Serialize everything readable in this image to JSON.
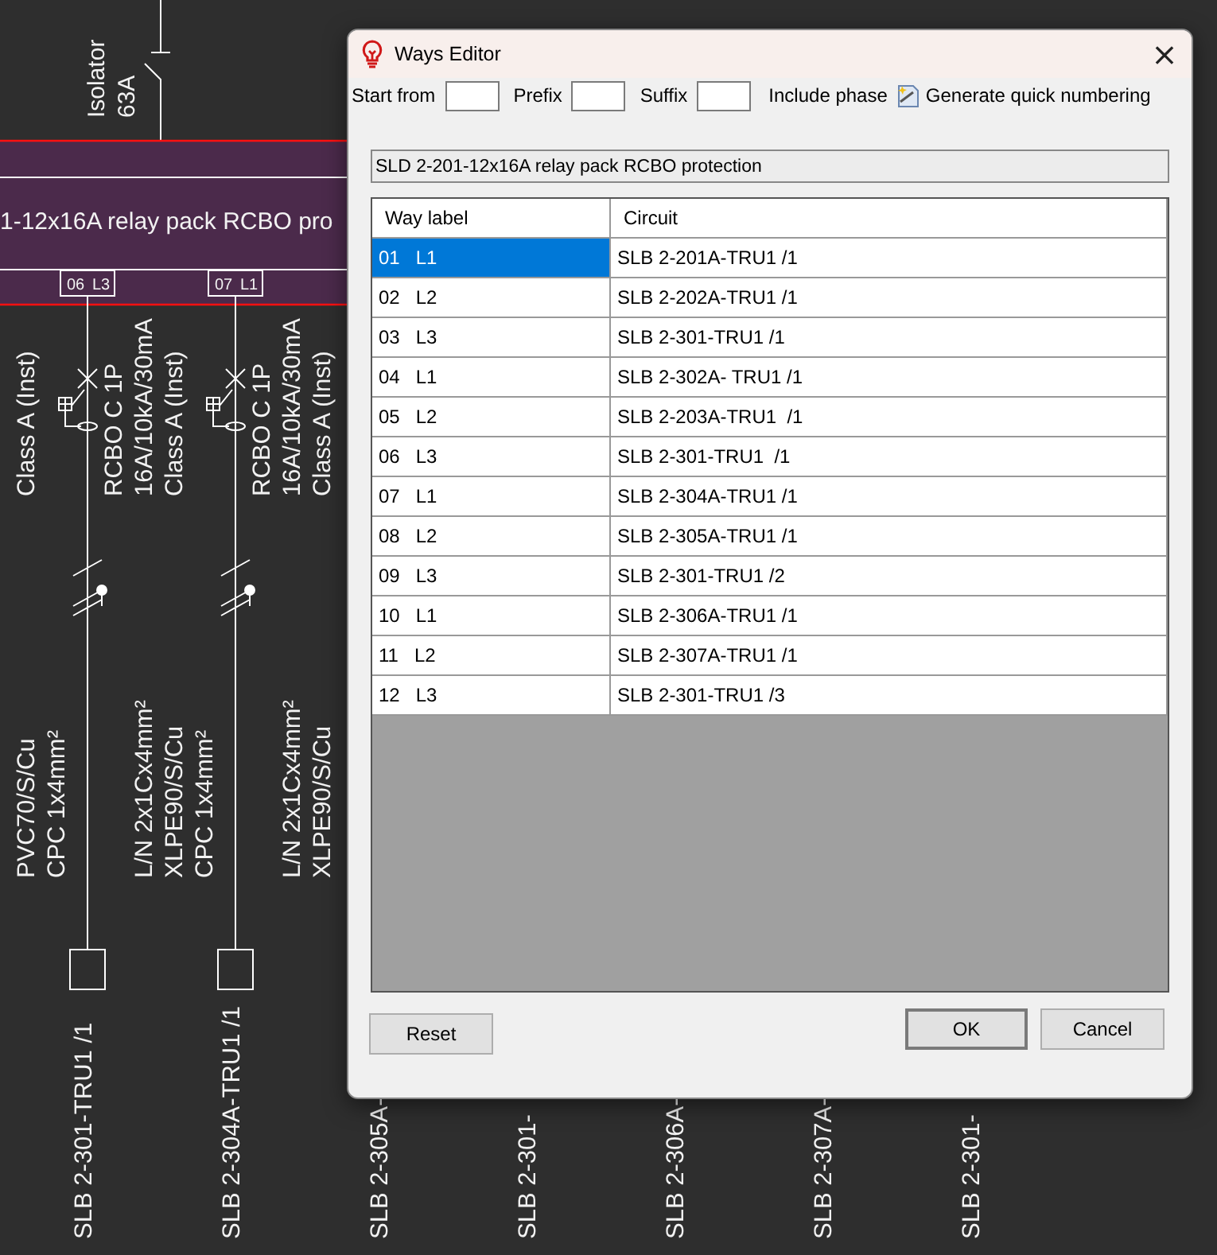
{
  "diagram": {
    "isolator": {
      "label": "Isolator",
      "rating": "63A"
    },
    "bus_text": "1-12x16A relay pack RCBO pro",
    "way_tags": [
      {
        "number": "06",
        "phase": "L3"
      },
      {
        "number": "07",
        "phase": "L1"
      }
    ],
    "device_columns": [
      [
        "Class A (Inst)"
      ],
      [
        "RCBO C 1P",
        "16A/10kA/30mA",
        "Class A (Inst)"
      ],
      [
        "RCBO C 1P",
        "16A/10kA/30mA",
        "Class A (Inst)"
      ]
    ],
    "cable_columns": [
      [
        "PVC70/S/Cu",
        "CPC 1x4mm²"
      ],
      [
        "L/N 2x1Cx4mm²",
        "XLPE90/S/Cu",
        "CPC 1x4mm²"
      ],
      [
        "L/N 2x1Cx4mm²",
        "XLPE90/S/Cu"
      ]
    ],
    "circuit_labels": [
      "SLB 2-301-TRU1  /1",
      "SLB 2-304A-TRU1 /1",
      "SLB 2-305A-",
      "SLB 2-301-",
      "SLB 2-306A-",
      "SLB 2-307A-",
      "SLB 2-301-"
    ]
  },
  "dialog": {
    "title": "Ways Editor",
    "close": "×",
    "toolbar": {
      "start_from": "Start from",
      "prefix": "Prefix",
      "suffix": "Suffix",
      "include_phase": "Include phase",
      "generate_button": "Generate quick numbering"
    },
    "board_name": "SLD 2-201-12x16A relay pack RCBO protection",
    "table": {
      "columns": [
        "Way label",
        "Circuit"
      ],
      "rows": [
        {
          "way_label": "01   L1",
          "circuit": "SLB 2-201A-TRU1 /1",
          "selected": true
        },
        {
          "way_label": "02   L2",
          "circuit": "SLB 2-202A-TRU1 /1",
          "selected": false
        },
        {
          "way_label": "03   L3",
          "circuit": "SLB 2-301-TRU1 /1",
          "selected": false
        },
        {
          "way_label": "04   L1",
          "circuit": "SLB 2-302A- TRU1 /1",
          "selected": false
        },
        {
          "way_label": "05   L2",
          "circuit": "SLB 2-203A-TRU1  /1",
          "selected": false
        },
        {
          "way_label": "06   L3",
          "circuit": "SLB 2-301-TRU1  /1",
          "selected": false
        },
        {
          "way_label": "07   L1",
          "circuit": "SLB 2-304A-TRU1 /1",
          "selected": false
        },
        {
          "way_label": "08   L2",
          "circuit": "SLB 2-305A-TRU1 /1",
          "selected": false
        },
        {
          "way_label": "09   L3",
          "circuit": "SLB 2-301-TRU1 /2",
          "selected": false
        },
        {
          "way_label": "10   L1",
          "circuit": "SLB 2-306A-TRU1 /1",
          "selected": false
        },
        {
          "way_label": "11   L2",
          "circuit": "SLB 2-307A-TRU1 /1",
          "selected": false
        },
        {
          "way_label": "12   L3",
          "circuit": "SLB 2-301-TRU1 /3",
          "selected": false
        }
      ]
    },
    "buttons": {
      "reset": "Reset",
      "ok": "OK",
      "cancel": "Cancel"
    }
  }
}
